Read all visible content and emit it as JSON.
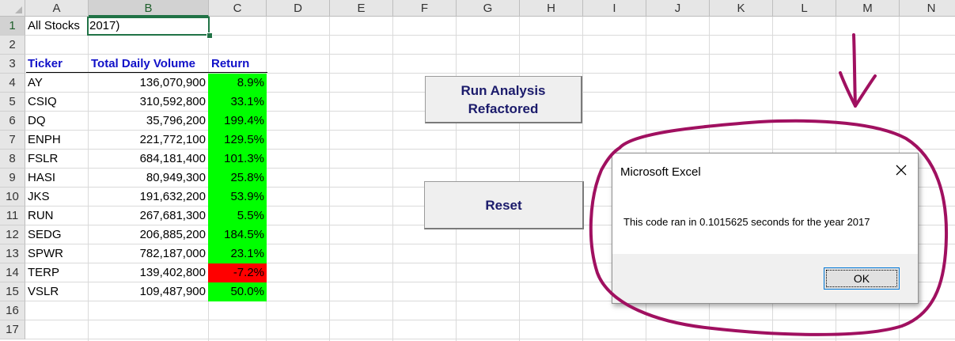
{
  "columns": [
    "A",
    "B",
    "C",
    "D",
    "E",
    "F",
    "G",
    "H",
    "I",
    "J",
    "K",
    "L",
    "M",
    "N"
  ],
  "rows": [
    "1",
    "2",
    "3",
    "4",
    "5",
    "6",
    "7",
    "8",
    "9",
    "10",
    "11",
    "12",
    "13",
    "14",
    "15",
    "16",
    "17"
  ],
  "cells": {
    "a1": "All Stocks",
    "b1": "2017)"
  },
  "table": {
    "headers": {
      "ticker": "Ticker",
      "volume": "Total Daily Volume",
      "return": "Return"
    },
    "rows": [
      {
        "ticker": "AY",
        "volume": "136,070,900",
        "return": "8.9%",
        "status": "positive"
      },
      {
        "ticker": "CSIQ",
        "volume": "310,592,800",
        "return": "33.1%",
        "status": "positive"
      },
      {
        "ticker": "DQ",
        "volume": "35,796,200",
        "return": "199.4%",
        "status": "positive"
      },
      {
        "ticker": "ENPH",
        "volume": "221,772,100",
        "return": "129.5%",
        "status": "positive"
      },
      {
        "ticker": "FSLR",
        "volume": "684,181,400",
        "return": "101.3%",
        "status": "positive"
      },
      {
        "ticker": "HASI",
        "volume": "80,949,300",
        "return": "25.8%",
        "status": "positive"
      },
      {
        "ticker": "JKS",
        "volume": "191,632,200",
        "return": "53.9%",
        "status": "positive"
      },
      {
        "ticker": "RUN",
        "volume": "267,681,300",
        "return": "5.5%",
        "status": "positive"
      },
      {
        "ticker": "SEDG",
        "volume": "206,885,200",
        "return": "184.5%",
        "status": "positive"
      },
      {
        "ticker": "SPWR",
        "volume": "782,187,000",
        "return": "23.1%",
        "status": "positive"
      },
      {
        "ticker": "TERP",
        "volume": "139,402,800",
        "return": "-7.2%",
        "status": "negative"
      },
      {
        "ticker": "VSLR",
        "volume": "109,487,900",
        "return": "50.0%",
        "status": "positive"
      }
    ]
  },
  "buttons": {
    "run_line1": "Run Analysis",
    "run_line2": "Refactored",
    "reset": "Reset"
  },
  "dialog": {
    "title": "Microsoft Excel",
    "message": "This code ran in 0.1015625 seconds for the year 2017",
    "ok": "OK"
  },
  "colors": {
    "positive": "#00ff00",
    "negative": "#ff0000",
    "header_text": "#1010c8",
    "annotation": "#a01060",
    "button_text": "#1b1b6b"
  },
  "icons": {
    "close": "close-icon",
    "annotation_arrow": "arrow-down-icon",
    "annotation_circle": "circle-annotation"
  }
}
